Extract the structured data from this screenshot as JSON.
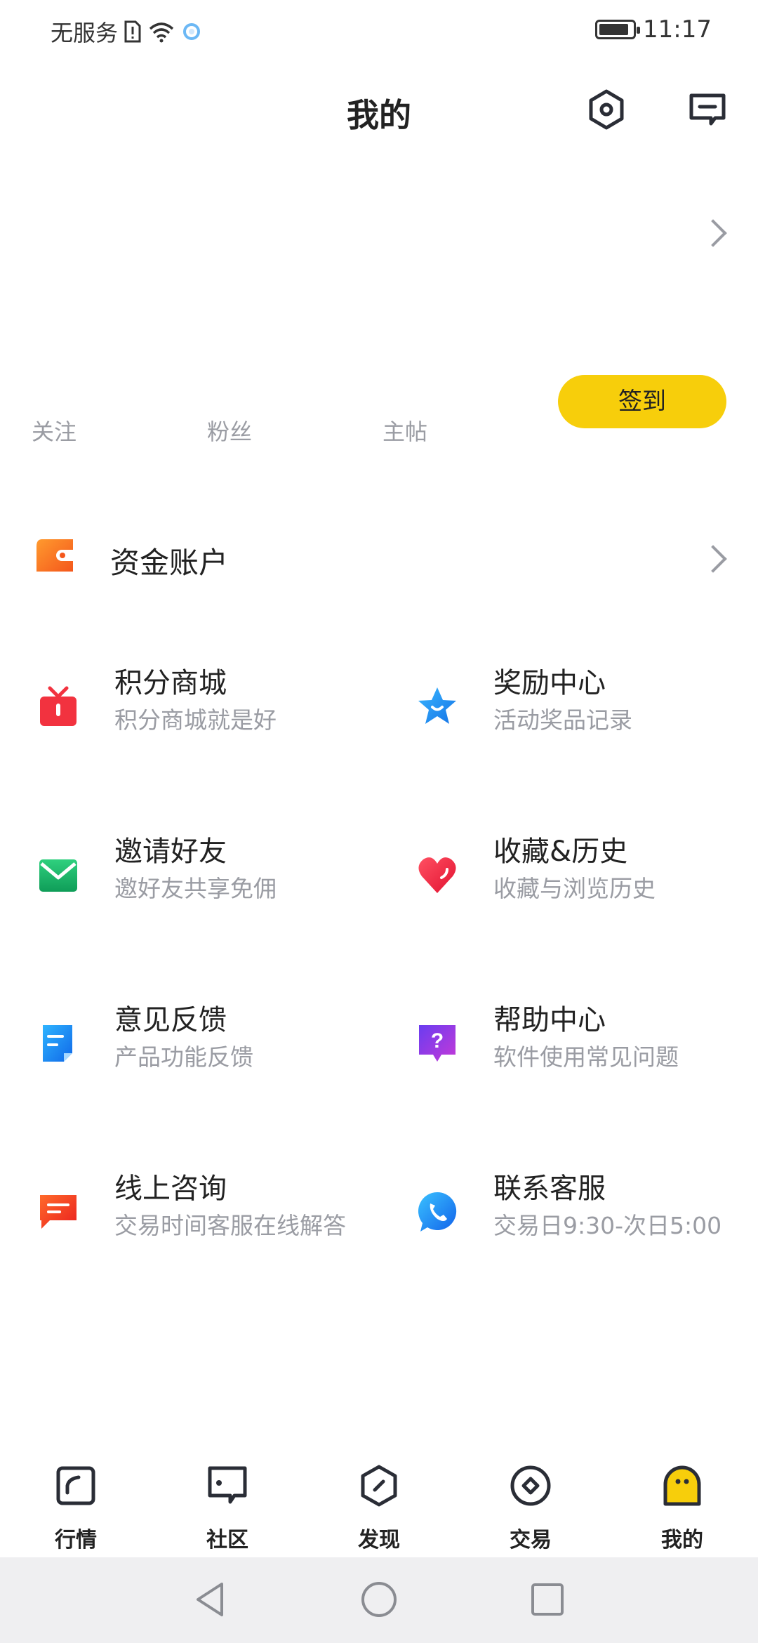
{
  "status_bar": {
    "carrier": "无服务",
    "time": "11:17",
    "battery_level": 0.9
  },
  "header": {
    "title": "我的",
    "settings_icon": "settings-hexagon-icon",
    "message_icon": "message-icon"
  },
  "stats": {
    "follow_label": "关注",
    "fans_label": "粉丝",
    "posts_label": "主帖",
    "signin_label": "签到"
  },
  "fund_account": {
    "label": "资金账户"
  },
  "features": [
    {
      "title": "积分商城",
      "subtitle": "积分商城就是好",
      "icon": "gift-icon",
      "color": "#f2323f"
    },
    {
      "title": "奖励中心",
      "subtitle": "活动奖品记录",
      "icon": "star-icon",
      "color": "#1e9bf0"
    },
    {
      "title": "邀请好友",
      "subtitle": "邀好友共享免佣",
      "icon": "envelope-icon",
      "color": "#19b36b"
    },
    {
      "title": "收藏&历史",
      "subtitle": "收藏与浏览历史",
      "icon": "heart-icon",
      "color": "#f0283c"
    },
    {
      "title": "意见反馈",
      "subtitle": "产品功能反馈",
      "icon": "feedback-icon",
      "color": "#1e8cf5"
    },
    {
      "title": "帮助中心",
      "subtitle": "软件使用常见问题",
      "icon": "help-icon",
      "color": "#8a3ff0"
    },
    {
      "title": "线上咨询",
      "subtitle": "交易时间客服在线解答",
      "icon": "chat-icon",
      "color": "#f5411e"
    },
    {
      "title": "联系客服",
      "subtitle": "交易日9:30-次日5:00",
      "icon": "phone-icon",
      "color": "#1e8cf5"
    }
  ],
  "bottom_nav": [
    {
      "label": "行情",
      "icon": "market-icon"
    },
    {
      "label": "社区",
      "icon": "community-icon"
    },
    {
      "label": "发现",
      "icon": "discover-icon"
    },
    {
      "label": "交易",
      "icon": "trade-icon"
    },
    {
      "label": "我的",
      "icon": "profile-icon",
      "active": true
    }
  ],
  "colors": {
    "accent": "#f7ce0b",
    "text_primary": "#222222",
    "text_secondary": "#9a9ca3"
  }
}
